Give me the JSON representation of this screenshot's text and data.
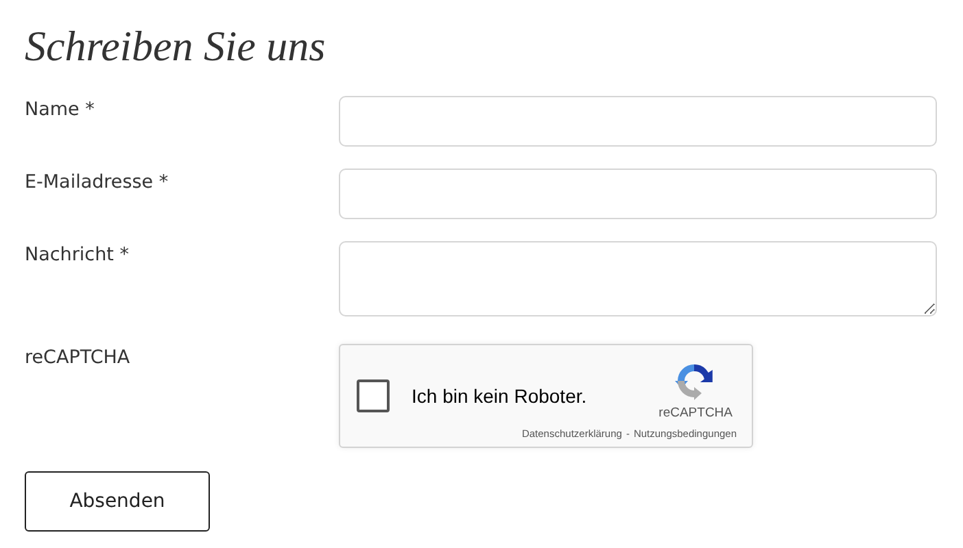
{
  "title": "Schreiben Sie uns",
  "fields": [
    {
      "label": "Name *",
      "kind": "input"
    },
    {
      "label": "E-Mailadresse *",
      "kind": "input"
    },
    {
      "label": "Nachricht *",
      "kind": "textarea"
    }
  ],
  "captcha": {
    "label": "reCAPTCHA",
    "checked": false,
    "text": "Ich bin kein Roboter.",
    "brand": "reCAPTCHA",
    "privacy": "Datenschutzerklärung",
    "separator": "-",
    "terms": "Nutzungsbedingungen"
  },
  "submit": "Absenden"
}
